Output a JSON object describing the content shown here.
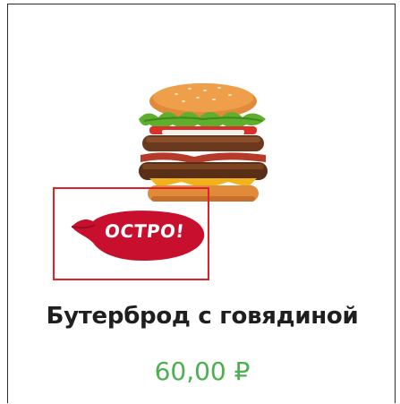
{
  "product": {
    "name": "Бутерброд с говядиной",
    "price": "60,00 ₽",
    "image_icon": "burger-image",
    "badge": {
      "text": "ОСТРО!",
      "color": "#c8102e"
    }
  },
  "colors": {
    "price": "#4caf50",
    "highlight_border": "#e0202a",
    "card_border": "#2a2a2a"
  }
}
